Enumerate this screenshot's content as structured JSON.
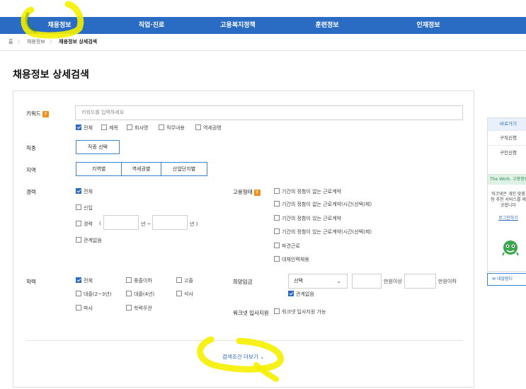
{
  "nav": {
    "items": [
      "채용정보",
      "직업·진로",
      "고용복지정책",
      "훈련정보",
      "인재정보"
    ]
  },
  "breadcrumb": {
    "home": "홈",
    "level1": "채용정보",
    "current": "채용정보 상세검색",
    "separator": "〉"
  },
  "page": {
    "title": "채용정보 상세검색"
  },
  "keyword": {
    "label": "키워드",
    "placeholder": "키워드를 입력하세요",
    "options": [
      {
        "label": "전체",
        "checked": true
      },
      {
        "label": "제목",
        "checked": false
      },
      {
        "label": "회사명",
        "checked": false
      },
      {
        "label": "직무내용",
        "checked": false
      },
      {
        "label": "역세권명",
        "checked": false
      }
    ]
  },
  "job_type": {
    "label": "직종",
    "button": "직종 선택"
  },
  "region": {
    "label": "지역",
    "buttons": [
      "지역별",
      "역세권별",
      "산업단지별"
    ]
  },
  "career": {
    "label": "경력",
    "all": "전체",
    "new": "신입",
    "experienced": "경력",
    "paren_open": "(",
    "year_from": "년 ~",
    "year_to": "년 )",
    "none": "관계없음"
  },
  "employment": {
    "label": "고용형태",
    "options": [
      "기간의 정함이 없는 근로계약",
      "기간의 정함이 없는 근로계약(시간(선택)제)",
      "기간의 정함이 있는 근로계약",
      "기간의 정함이 있는 근로계약(시간(선택)제)",
      "파견근로",
      "대체인력채용"
    ]
  },
  "education": {
    "label": "학력",
    "options": [
      {
        "label": "전체",
        "checked": true
      },
      {
        "label": "중졸이하",
        "checked": false
      },
      {
        "label": "고졸",
        "checked": false
      },
      {
        "label": "대졸(2~3년)",
        "checked": false
      },
      {
        "label": "대졸(4년)",
        "checked": false
      },
      {
        "label": "석사",
        "checked": false
      },
      {
        "label": "박사",
        "checked": false
      },
      {
        "label": "학력무관",
        "checked": false
      }
    ]
  },
  "wage": {
    "label": "희망임금",
    "select_value": "선택",
    "min_unit": "만원이상 ~",
    "max_unit": "만원이하",
    "none": "관계없음"
  },
  "worknet": {
    "label": "워크넷 입사지원",
    "option": "워크넷 입사지원 가능"
  },
  "more_button": "검색조건 더보기",
  "sidebar": {
    "title": "바로가기",
    "items": [
      "구직신청",
      "구인신청"
    ]
  },
  "promo": {
    "title": "The Work. 고용정보",
    "text": "워크넷은 개인 맞춤형 추천 서비스를 제공합니다",
    "link": "로그인하기"
  },
  "inbox": {
    "label": "내알림디"
  },
  "colors": {
    "primary": "#2a6cc4",
    "accent": "#f0901c",
    "highlight": "#ffff00"
  }
}
